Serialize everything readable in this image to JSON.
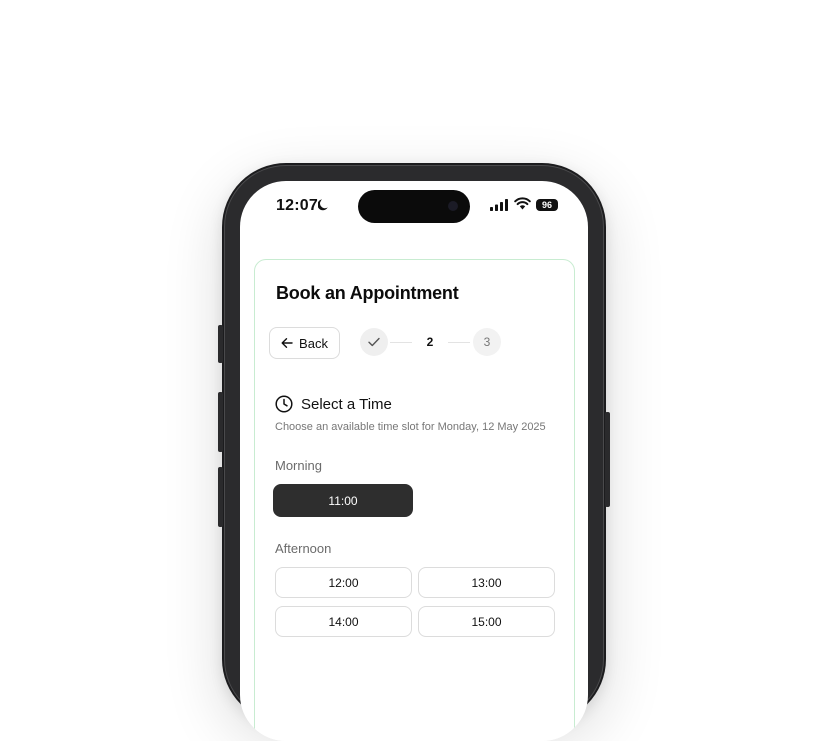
{
  "status_bar": {
    "time": "12:07",
    "battery": "96"
  },
  "booking": {
    "title": "Book an Appointment",
    "back_label": "Back",
    "steps": {
      "current": "2",
      "next": "3"
    },
    "section_title": "Select a Time",
    "subtitle": "Choose an available time slot for Monday, 12 May 2025",
    "morning": {
      "label": "Morning",
      "slots": [
        "11:00"
      ],
      "selected": "11:00"
    },
    "afternoon": {
      "label": "Afternoon",
      "slots": [
        "12:00",
        "13:00",
        "14:00",
        "15:00"
      ]
    }
  },
  "colors": {
    "selected_slot": "#2e2e2e",
    "card_border": "#c8ecd1"
  }
}
